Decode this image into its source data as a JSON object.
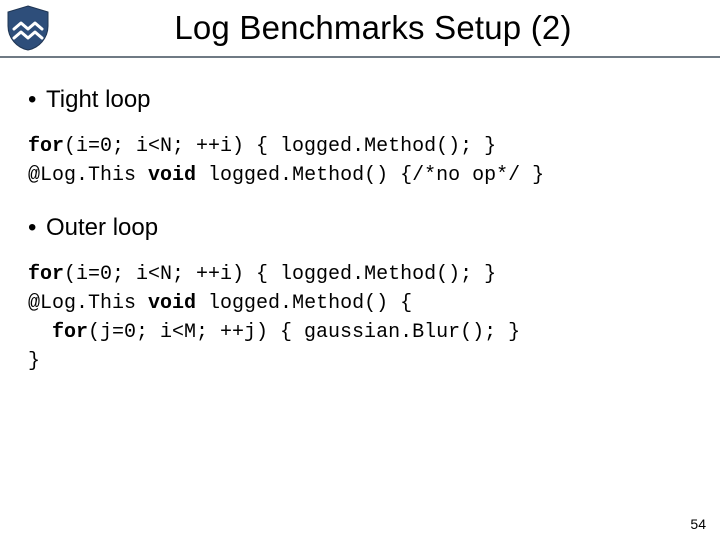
{
  "header": {
    "title": "Log Benchmarks Setup (2)"
  },
  "bullets": {
    "tight": "Tight loop",
    "outer": "Outer loop"
  },
  "code": {
    "tight": {
      "l1a": "for",
      "l1b": "(i=0; i<N; ++i) { logged.Method(); }",
      "l2a": "@Log.This ",
      "l2b": "void",
      "l2c": " logged.Method() {/*no op*/ }"
    },
    "outer": {
      "l1a": "for",
      "l1b": "(i=0; i<N; ++i) { logged.Method(); }",
      "l2a": "@Log.This ",
      "l2b": "void",
      "l2c": " logged.Method() {",
      "l3a": "  for",
      "l3b": "(j=0; i<M; ++j) { gaussian.Blur(); }",
      "l4": "}"
    }
  },
  "page_number": "54"
}
